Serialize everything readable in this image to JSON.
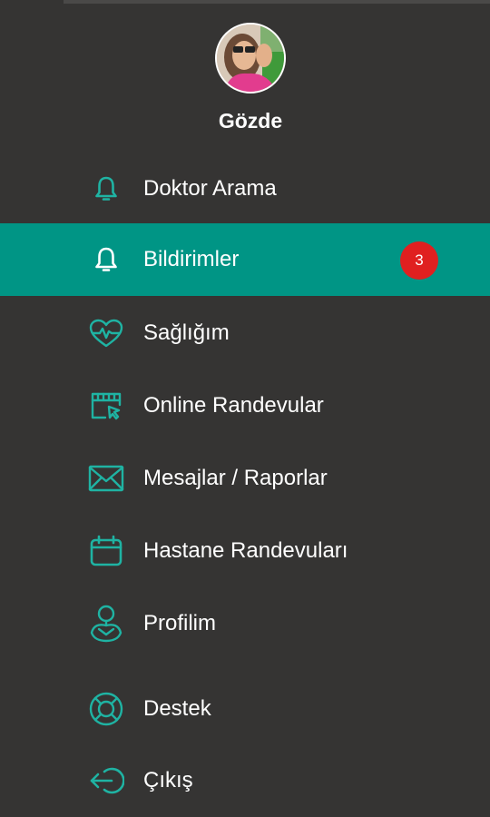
{
  "profile": {
    "name": "Gözde"
  },
  "colors": {
    "background": "#353433",
    "accent": "#009585",
    "icon": "#1fb3a3",
    "badge": "#e02020",
    "text": "#ffffff"
  },
  "menu": {
    "items": [
      {
        "label": "Doktor Arama",
        "icon": "bell-icon"
      },
      {
        "label": "Bildirimler",
        "icon": "bell-icon",
        "active": true,
        "badge": "3"
      },
      {
        "label": "Sağlığım",
        "icon": "heart-pulse-icon"
      },
      {
        "label": "Online Randevular",
        "icon": "calendar-cursor-icon"
      },
      {
        "label": "Mesajlar / Raporlar",
        "icon": "envelope-icon"
      },
      {
        "label": "Hastane Randevuları",
        "icon": "calendar-icon"
      },
      {
        "label": "Profilim",
        "icon": "user-icon"
      },
      {
        "label": "Destek",
        "icon": "lifebuoy-icon"
      },
      {
        "label": "Çıkış",
        "icon": "logout-icon"
      }
    ]
  }
}
